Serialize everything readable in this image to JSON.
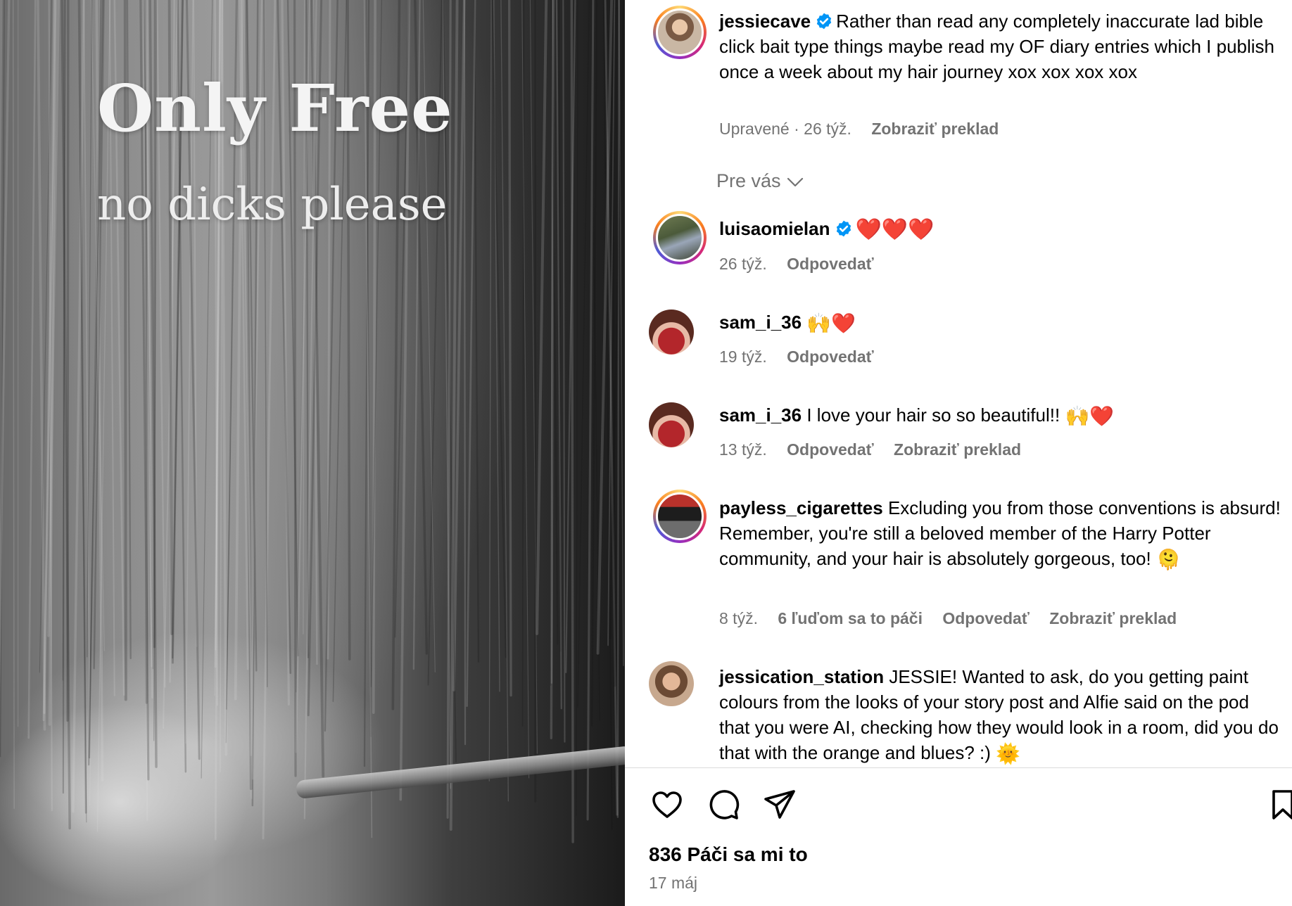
{
  "media": {
    "title_line1": "Only Free",
    "title_line2": "no dicks please"
  },
  "caption": {
    "username": "jessiecave",
    "verified": true,
    "text": "Rather than read any completely inaccurate lad bible click bait type things maybe read my OF diary entries which I publish once a week about my hair journey xox xox xox xox",
    "edited_label": "Upravené · 26 týž.",
    "translate_label": "Zobraziť preklad"
  },
  "filter": {
    "label": "Pre vás",
    "icon": "chevron-down-icon"
  },
  "comments": [
    {
      "username": "luisaomielan",
      "verified": true,
      "text": "",
      "emoji": "❤️❤️❤️",
      "time": "26 týž.",
      "reply_label": "Odpovedať",
      "likes_label": "",
      "translate_label": ""
    },
    {
      "username": "sam_i_36",
      "verified": false,
      "text": "",
      "emoji": "🙌❤️",
      "time": "19 týž.",
      "reply_label": "Odpovedať",
      "likes_label": "",
      "translate_label": ""
    },
    {
      "username": "sam_i_36",
      "verified": false,
      "text": "I love your hair so so beautiful!!",
      "emoji": "🙌❤️",
      "time": "13 týž.",
      "reply_label": "Odpovedať",
      "likes_label": "",
      "translate_label": "Zobraziť preklad"
    },
    {
      "username": "payless_cigarettes",
      "verified": false,
      "text": "Excluding you from those conventions is absurd! Remember, you're still a beloved member of the Harry Potter community, and your hair is absolutely gorgeous, too!",
      "emoji": "🫠",
      "time": "8 týž.",
      "reply_label": "Odpovedať",
      "likes_label": "6 ľuďom sa to páči",
      "translate_label": "Zobraziť preklad"
    },
    {
      "username": "jessication_station",
      "verified": false,
      "text": "JESSIE! Wanted to ask, do you getting paint colours from the looks of your story post and Alfie said on the pod that you were AI, checking how they would look in a room, did you do that with the orange and blues? :)",
      "emoji": "🌞",
      "time": "",
      "reply_label": "",
      "likes_label": "",
      "translate_label": ""
    }
  ],
  "actions": {
    "like_icon": "heart-outline-icon",
    "comment_icon": "comment-bubble-icon",
    "share_icon": "paper-plane-icon",
    "save_icon": "bookmark-icon"
  },
  "footer": {
    "likes": "836 Páči sa mi to",
    "date": "17 máj"
  },
  "colors": {
    "secondary_text": "#737373",
    "verified_blue": "#0095f6",
    "heart_red": "#e8112d"
  }
}
